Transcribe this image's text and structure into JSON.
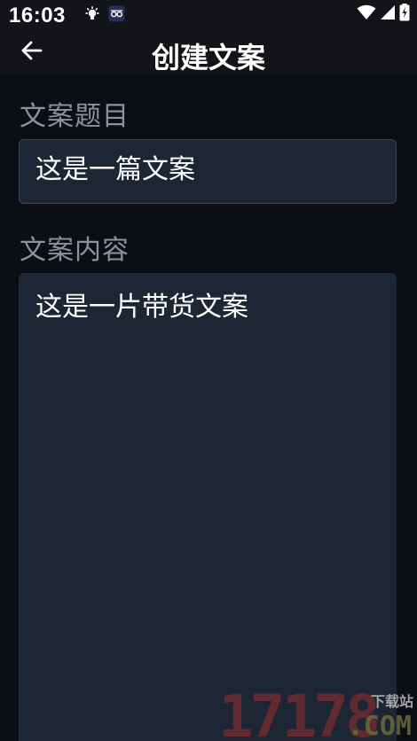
{
  "status_bar": {
    "time": "16:03",
    "icons": [
      "bulb-icon",
      "app-notification-icon",
      "wifi-icon",
      "cellular-signal-icon",
      "battery-charging-icon"
    ]
  },
  "app_bar": {
    "back_icon": "arrow-left-icon",
    "title": "创建文案"
  },
  "form": {
    "title_label": "文案题目",
    "title_value": "这是一篇文案",
    "content_label": "文案内容",
    "content_value": "这是一片带货文案"
  },
  "watermark": {
    "number": "17178",
    "site_label": "下载站",
    "domain": ".COM"
  },
  "colors": {
    "background": "#0b0e13",
    "bar_background": "#121418",
    "field_background": "#1d2634",
    "field_border": "#3a4556",
    "label_text": "#8b93a3",
    "text": "#ffffff"
  }
}
